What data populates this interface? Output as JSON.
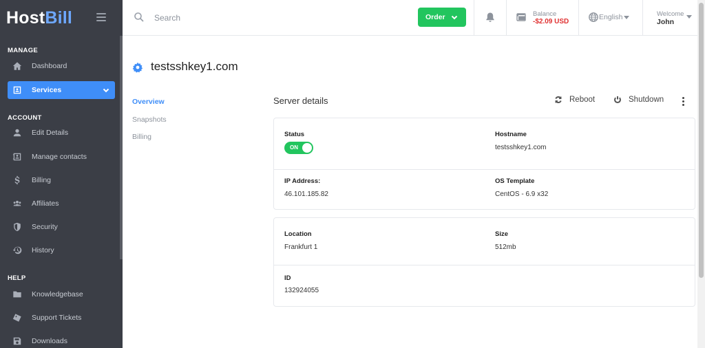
{
  "brand": {
    "part1": "Host",
    "part2": "Bill"
  },
  "sidebar": {
    "sections": [
      {
        "title": "MANAGE"
      },
      {
        "title": "ACCOUNT"
      },
      {
        "title": "HELP"
      }
    ],
    "items": [
      {
        "label": "Dashboard",
        "icon": "home-icon"
      },
      {
        "label": "Services",
        "icon": "services-icon",
        "active": true
      },
      {
        "label": "Edit Details",
        "icon": "user-icon"
      },
      {
        "label": "Manage contacts",
        "icon": "contacts-icon"
      },
      {
        "label": "Billing",
        "icon": "dollar-icon"
      },
      {
        "label": "Affiliates",
        "icon": "affiliates-icon"
      },
      {
        "label": "Security",
        "icon": "shield-icon"
      },
      {
        "label": "History",
        "icon": "history-icon"
      },
      {
        "label": "Knowledgebase",
        "icon": "folder-icon"
      },
      {
        "label": "Support Tickets",
        "icon": "ticket-icon"
      },
      {
        "label": "Downloads",
        "icon": "save-icon"
      }
    ]
  },
  "topbar": {
    "search_placeholder": "Search",
    "order_label": "Order",
    "balance_label": "Balance",
    "balance_value": "-$2.09 USD",
    "language": "English",
    "welcome_label": "Welcome",
    "username": "John"
  },
  "page": {
    "title": "testsshkey1.com",
    "subnav": [
      {
        "label": "Overview",
        "active": true
      },
      {
        "label": "Snapshots"
      },
      {
        "label": "Billing"
      }
    ],
    "section_heading": "Server details",
    "reboot_label": "Reboot",
    "shutdown_label": "Shutdown"
  },
  "server": {
    "status_label": "Status",
    "status_toggle": "ON",
    "hostname_label": "Hostname",
    "hostname": "testsshkey1.com",
    "ip_label": "IP Address:",
    "ip": "46.101.185.82",
    "os_label": "OS Template",
    "os": "CentOS - 6.9 x32",
    "location_label": "Location",
    "location": "Frankfurt 1",
    "size_label": "Size",
    "size": "512mb",
    "id_label": "ID",
    "id": "132924055"
  },
  "colors": {
    "sidebar_bg": "#3b3e46",
    "accent_blue": "#3f8ef8",
    "order_green": "#22c55e",
    "balance_red": "#e03131"
  }
}
